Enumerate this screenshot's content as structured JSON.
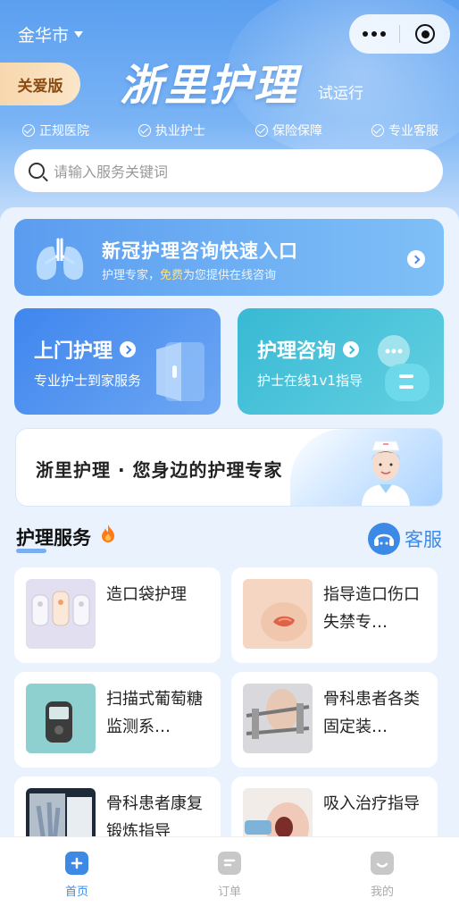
{
  "header": {
    "city": "金华市",
    "care_badge": "关爱版",
    "brand": "浙里护理",
    "brand_sub": "试运行",
    "features": [
      "正规医院",
      "执业护士",
      "保险保障",
      "专业客服"
    ]
  },
  "search": {
    "placeholder": "请输入服务关键词"
  },
  "consult_banner": {
    "title": "新冠护理咨询快速入口",
    "desc_before": "护理专家，",
    "desc_highlight": "免费",
    "desc_after": "为您提供在线咨询"
  },
  "cards": {
    "home_visit": {
      "title": "上门护理",
      "desc": "专业护士到家服务"
    },
    "consult": {
      "title": "护理咨询",
      "desc": "护士在线1v1指导"
    }
  },
  "promo": {
    "text": "浙里护理 · 您身边的护理专家"
  },
  "section": {
    "title": "护理服务",
    "service_label": "客服"
  },
  "services": [
    {
      "label": "造口袋护理",
      "icon": "ostomy-bag-photo"
    },
    {
      "label": "指导造口伤口失禁专…",
      "icon": "wound-photo"
    },
    {
      "label": "扫描式葡萄糖监测系…",
      "icon": "glucose-monitor-photo"
    },
    {
      "label": "骨科患者各类固定装…",
      "icon": "orthopedic-brace-photo"
    },
    {
      "label": "骨科患者康复锻炼指导",
      "icon": "xray-photo"
    },
    {
      "label": "吸入治疗指导",
      "icon": "inhaler-photo"
    }
  ],
  "tabbar": [
    {
      "label": "首页",
      "active": true
    },
    {
      "label": "订单",
      "active": false
    },
    {
      "label": "我的",
      "active": false
    }
  ],
  "colors": {
    "primary": "#3d8ae6",
    "teal": "#38b9d4",
    "care_badge": "#f7d7ad"
  }
}
